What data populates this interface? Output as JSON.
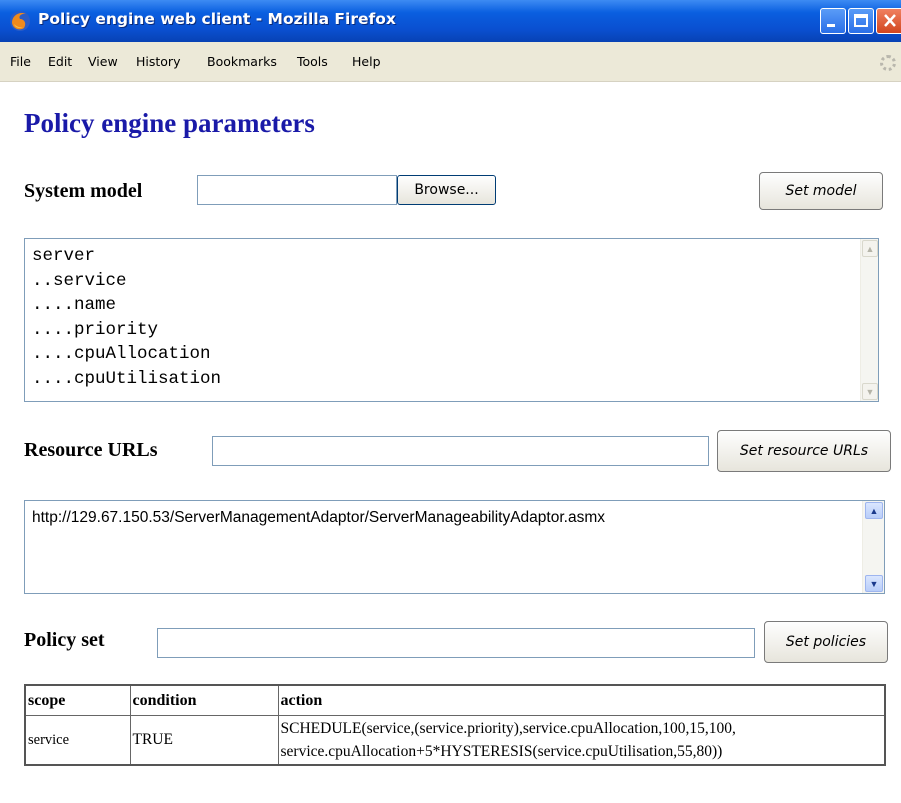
{
  "window": {
    "title": "Policy engine web client - Mozilla Firefox"
  },
  "menubar": {
    "items": [
      "File",
      "Edit",
      "View",
      "History",
      "Bookmarks",
      "Tools",
      "Help"
    ]
  },
  "page": {
    "heading": "Policy engine parameters"
  },
  "system_model": {
    "label": "System model",
    "file_value": "",
    "browse_label": "Browse...",
    "set_label": "Set model",
    "lines": [
      "server",
      "..service",
      "....name",
      "....priority",
      "....cpuAllocation",
      "....cpuUtilisation"
    ]
  },
  "resource_urls": {
    "label": "Resource URLs",
    "input_value": "",
    "set_label": "Set resource URLs",
    "lines": [
      "http://129.67.150.53/ServerManagementAdaptor/ServerManageabilityAdaptor.asmx"
    ]
  },
  "policy_set": {
    "label": "Policy set",
    "input_value": "",
    "set_label": "Set policies",
    "table": {
      "headers": [
        "scope",
        "condition",
        "action"
      ],
      "rows": [
        {
          "scope": "service",
          "condition": "TRUE",
          "action_line1": "SCHEDULE(service,(service.priority),service.cpuAllocation,100,15,100,",
          "action_line2": "service.cpuAllocation+5*HYSTERESIS(service.cpuUtilisation,55,80))"
        }
      ]
    }
  },
  "icons": {
    "app_icon": "firefox-icon",
    "minimize": "minimize-icon",
    "maximize": "maximize-icon",
    "close": "close-icon",
    "throbber": "throbber-icon"
  },
  "colors": {
    "titlebar": "#0a4fd0",
    "heading": "#1a1aa8",
    "close_button": "#d2451e"
  }
}
